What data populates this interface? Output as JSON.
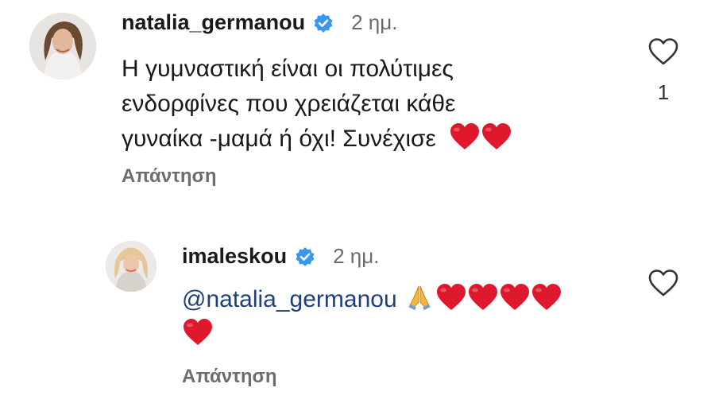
{
  "comments": [
    {
      "username": "natalia_germanou",
      "time": "2 ημ.",
      "text_lines": [
        "Η γυμναστική είναι οι πολύτιμες",
        "ενδορφίνες που χρειάζεται κάθε",
        "γυναίκα -μαμά ή όχι! Συνέχισε"
      ],
      "reply_label": "Απάντηση",
      "like_count": "1",
      "icons": [
        "avatar",
        "verified-badge-icon",
        "heart-outline-icon",
        "red-heart-emoji",
        "red-heart-emoji"
      ]
    },
    {
      "username": "imaleskou",
      "time": "2 ημ.",
      "mention": "@natalia_germanou",
      "reply_label": "Απάντηση",
      "icons": [
        "avatar",
        "verified-badge-icon",
        "heart-outline-icon",
        "folded-hands-emoji",
        "red-heart-emoji",
        "red-heart-emoji",
        "red-heart-emoji",
        "red-heart-emoji",
        "red-heart-emoji"
      ]
    }
  ],
  "colors": {
    "verified": "#3897f0",
    "mention": "#1f3f7a",
    "heart": "#e0182d",
    "secondary_text": "#6d6d6d"
  }
}
